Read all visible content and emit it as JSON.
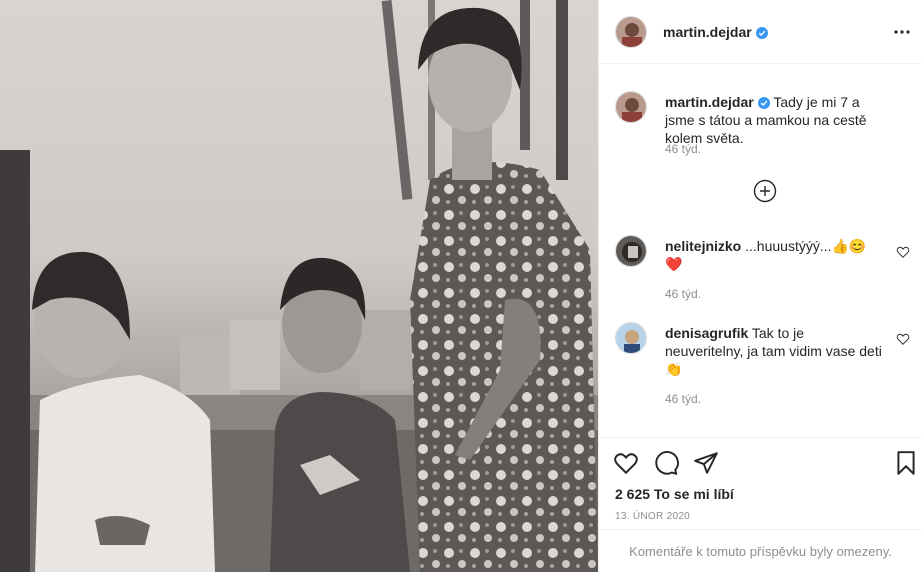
{
  "photo": {
    "alt": ""
  },
  "post": {
    "username": "martin.dejdar",
    "verified_icon": "verified-badge-icon",
    "more_icon": "more-options-icon"
  },
  "caption": {
    "username": "martin.dejdar",
    "text": "Tady je mi 7 a jsme s tátou a mamkou na cestě kolem světa.",
    "time": "46 týd."
  },
  "load_more_icon": "plus-circle-icon",
  "comments": [
    {
      "username": "nelitejnizko",
      "text": "...huuustýýý...👍😊",
      "extra": "❤️",
      "time": "46 týd."
    },
    {
      "username": "denisagrufik",
      "text": "Tak to je neuveritelny, ja tam vidim vase deti 👏",
      "time": "46 týd."
    }
  ],
  "actions": {
    "like_icon": "heart-icon",
    "comment_icon": "comment-icon",
    "share_icon": "paper-plane-icon",
    "save_icon": "bookmark-icon"
  },
  "likes": "2 625 To se mi líbí",
  "date": "13. ÚNOR 2020",
  "comments_limited": "Komentáře k tomuto příspěvku byly omezeny."
}
